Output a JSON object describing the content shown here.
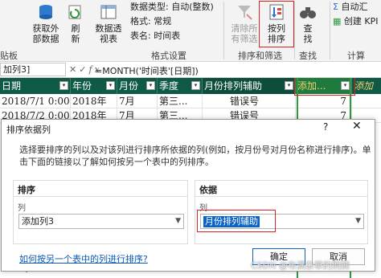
{
  "ribbon": {
    "sheet_label": "贴板",
    "get_data_label_1": "获取外",
    "get_data_label_2": "部数据",
    "refresh_label_1": "刷",
    "refresh_label_2": "新",
    "pivot_label_1": "数据透",
    "pivot_label_2": "视表",
    "data_type": "数据类型: 自动(整数)",
    "format": "格式: 常规",
    "table_name": "表名: 时间表",
    "format_settings_group": "格式设置",
    "clear_filter_1": "清除所",
    "clear_filter_2": "有筛选",
    "sort_by_col_1": "按列",
    "sort_by_col_2": "排序",
    "sort_filter_group": "排序和筛选",
    "find_1": "查",
    "find_2": "找",
    "find_group": "查找",
    "autosum": "自动汇",
    "create_kpi": "创建 KPI",
    "calc_group": "计算"
  },
  "formula_bar": {
    "name_box": "加列3]",
    "formula": "=MONTH('时间表'[日期])"
  },
  "sheet": {
    "headers": [
      "日期",
      "年份",
      "月份",
      "季度",
      "月份排列辅助",
      "添加...",
      "添加"
    ],
    "rows": [
      [
        "2018/7/1 0:00...",
        "2018年",
        "7月",
        "第三...",
        "错误号",
        "7"
      ],
      [
        "2018/7/2 0:00...",
        "2018年",
        "7月",
        "第三...",
        "错误号",
        "7"
      ]
    ],
    "left_partial_rows": [
      "2018/7/",
      "2018/7/",
      "2018/7/",
      "2018/7/",
      "2018/7/"
    ]
  },
  "dialog": {
    "title": "排序依据列",
    "help": "?",
    "close": "✕",
    "description": "选择要排序的列以及对该列进行排序所依据的列(例如，按月份号对月份名称进行排序)。单击下面的链接以了解如何按另一个表中的列排序。",
    "sort_section": "排序",
    "sort_col_label": "列",
    "sort_col_value": "添加列3",
    "by_section": "依据",
    "by_col_label": "列",
    "by_col_value": "月份排列辅助",
    "link": "如何按另一个表中的列进行排序?",
    "ok": "确定",
    "cancel": "取消"
  },
  "watermark": "CSDN @布满杂草的荆棘",
  "colors": {
    "header_bg": "#0f5a47",
    "accent_red": "#e02020",
    "selection_blue": "#0a63c9",
    "highlight_green": "#2e9a3e"
  }
}
